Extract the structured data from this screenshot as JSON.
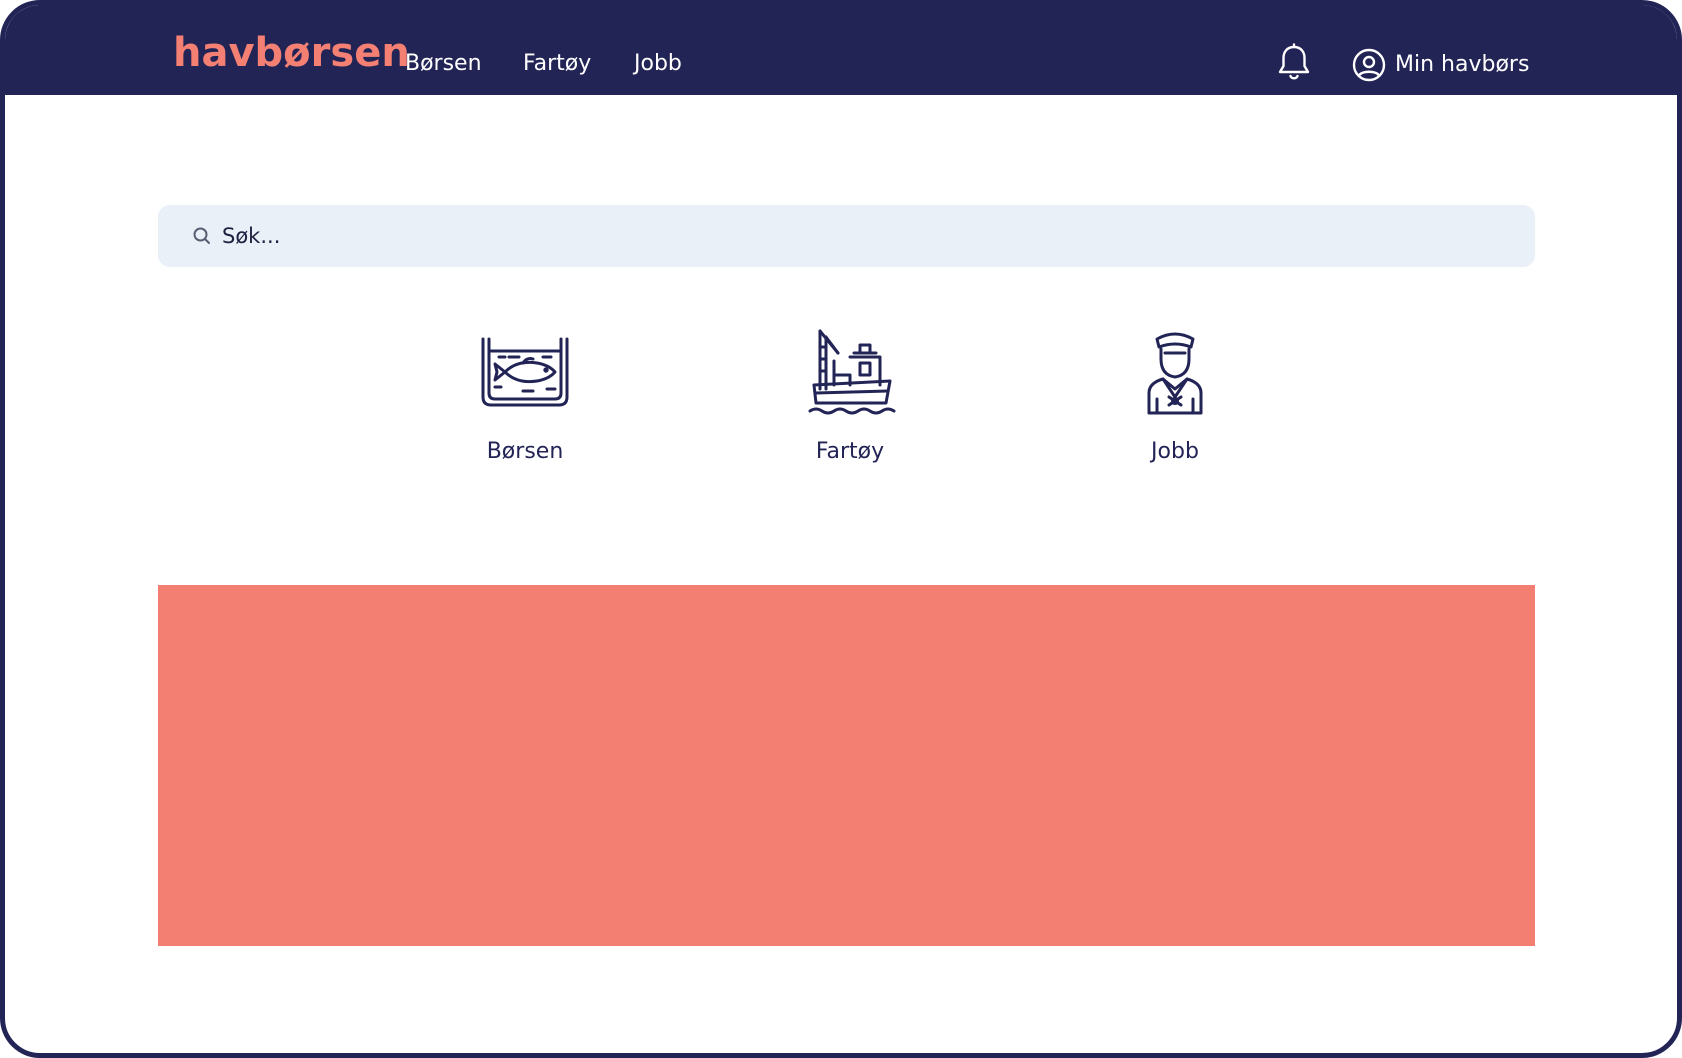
{
  "header": {
    "logo": "havbørsen",
    "nav": [
      {
        "label": "Børsen"
      },
      {
        "label": "Fartøy"
      },
      {
        "label": "Jobb"
      }
    ],
    "account_label": "Min havbørs"
  },
  "search": {
    "placeholder": "Søk..."
  },
  "categories": [
    {
      "label": "Børsen",
      "icon": "fish-tank-icon"
    },
    {
      "label": "Fartøy",
      "icon": "fishing-boat-icon"
    },
    {
      "label": "Jobb",
      "icon": "sailor-icon"
    }
  ],
  "colors": {
    "navy": "#232456",
    "coral": "#f37f73",
    "search_bg": "#e9f0f8"
  }
}
